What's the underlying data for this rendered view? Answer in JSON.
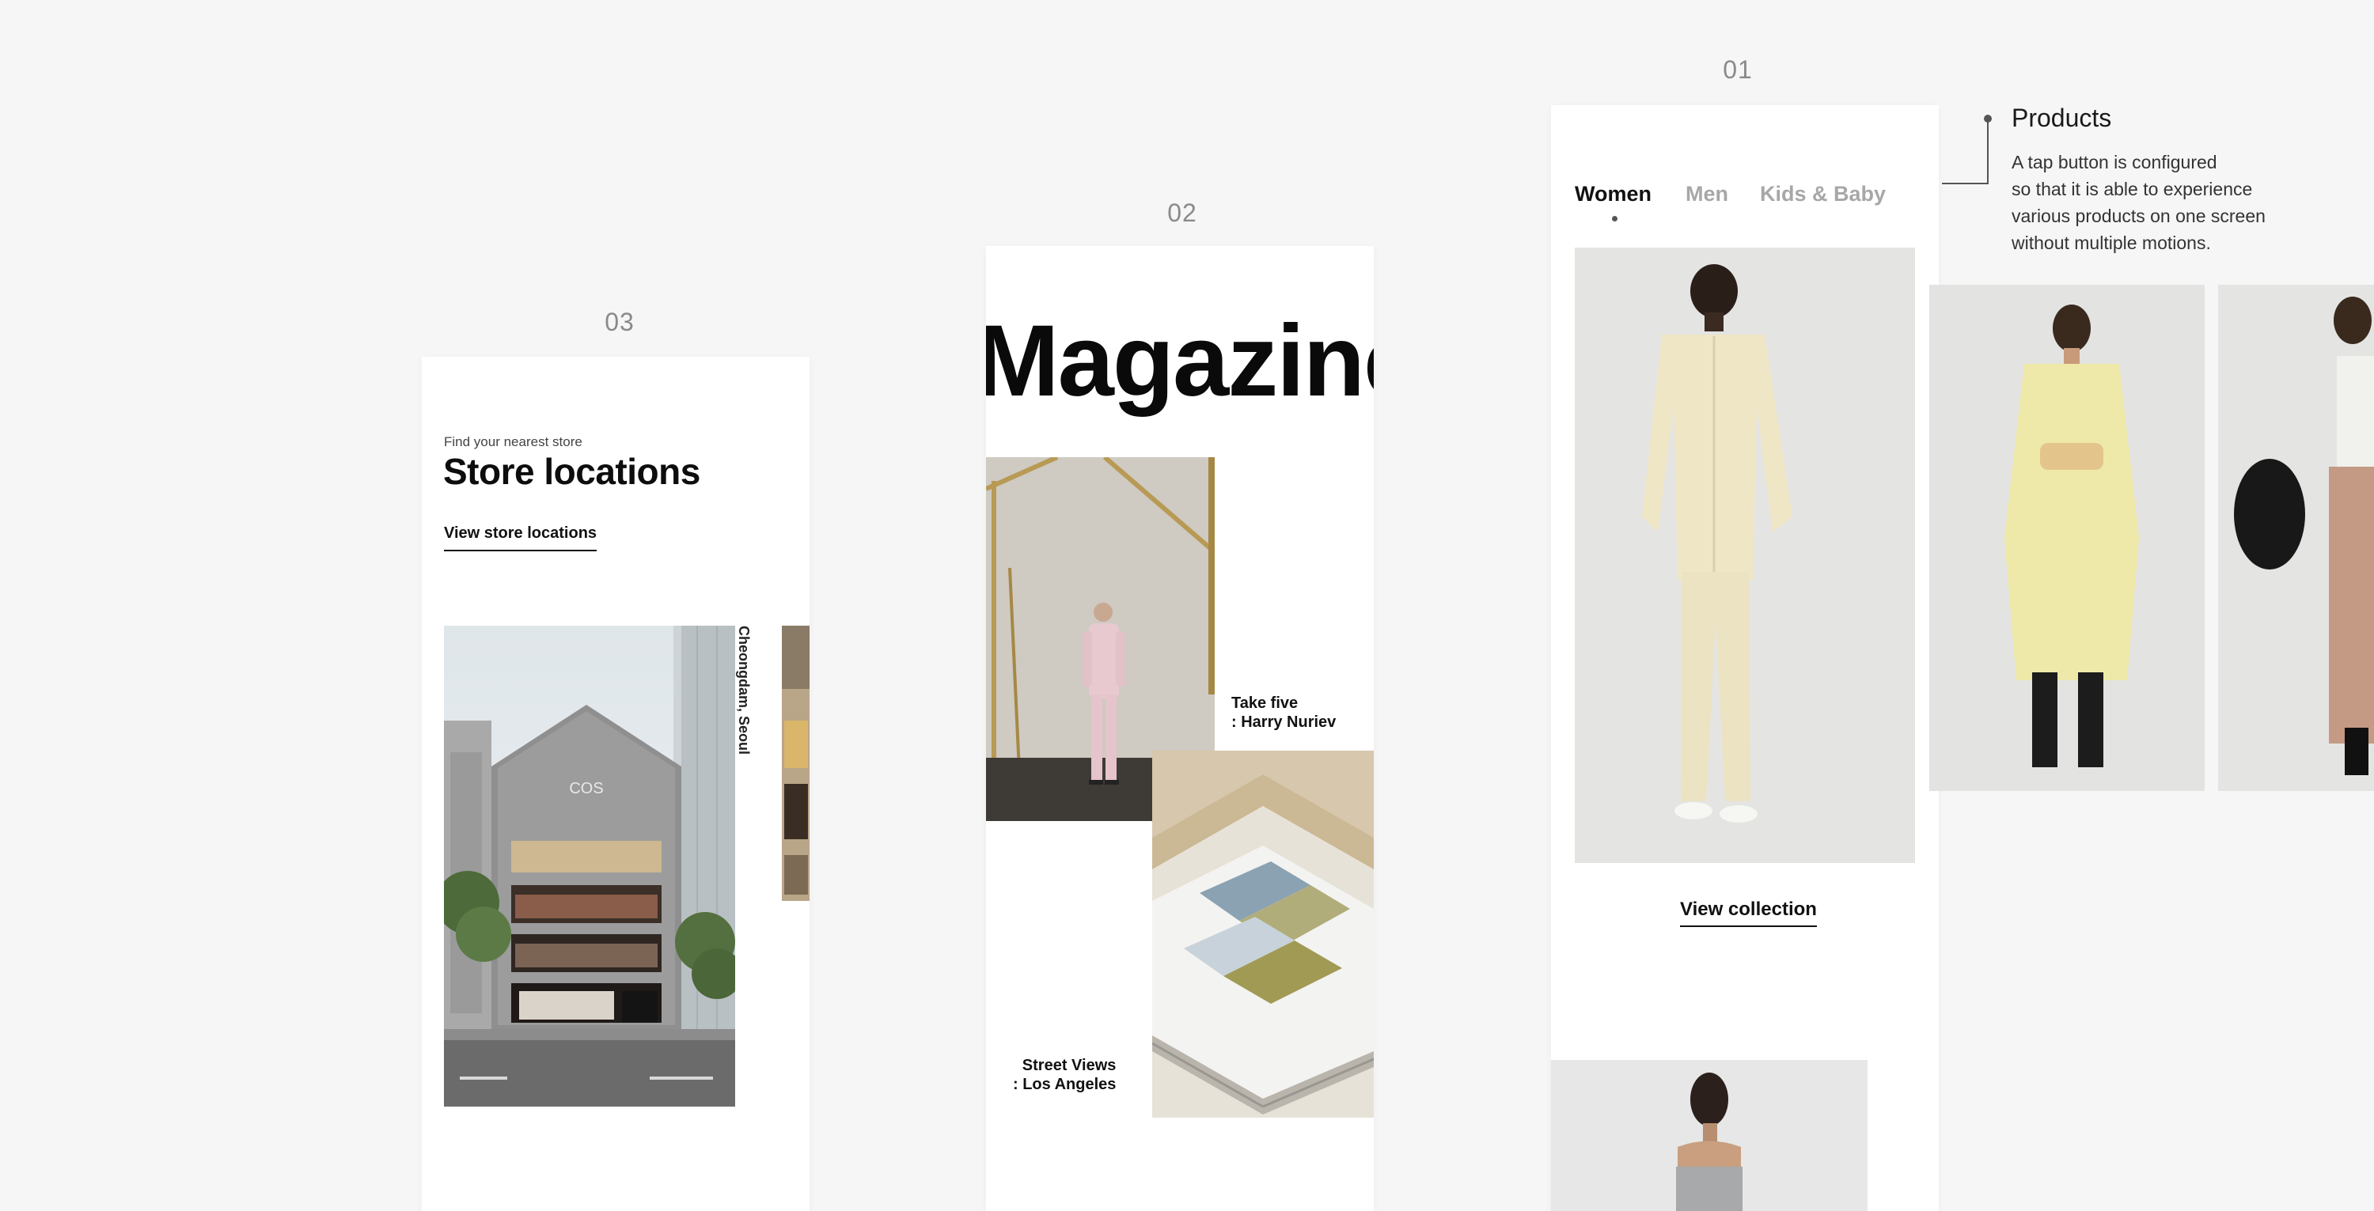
{
  "screens": {
    "s3": {
      "number": "03"
    },
    "s2": {
      "number": "02"
    },
    "s1": {
      "number": "01"
    }
  },
  "store": {
    "subtitle": "Find your nearest store",
    "title": "Store locations",
    "link": "View store locations",
    "caption": "Cheongdam, Seoul",
    "building_sign": "COS"
  },
  "magazine": {
    "title": "Magazine",
    "article1_caption": "Take five\n: Harry Nuriev",
    "article2_caption": "Street Views\n: Los Angeles"
  },
  "products": {
    "tabs": [
      "Women",
      "Men",
      "Kids & Baby"
    ],
    "active_tab": "Women",
    "view_collection": "View collection"
  },
  "annotation": {
    "title": "Products",
    "text": "A tap button is configured\nso that it is able to experience\nvarious products on one screen\nwithout multiple motions."
  },
  "colors": {
    "background": "#f6f6f6",
    "card": "#ffffff",
    "text": "#111111",
    "muted_tab": "#a7a7a7",
    "label_number": "#8a8a8a"
  }
}
